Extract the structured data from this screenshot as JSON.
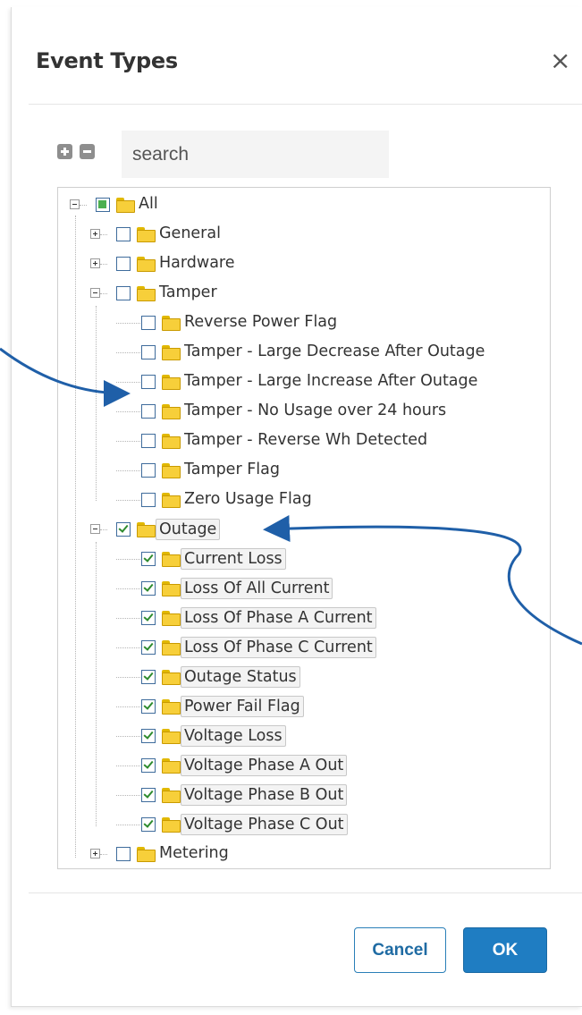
{
  "dialog": {
    "title": "Event Types",
    "close_icon": "×",
    "close_icon_name": "close-icon"
  },
  "toolbar": {
    "expand_all_icon": "plus-square-icon",
    "collapse_all_icon": "minus-square-icon",
    "search_placeholder": "search",
    "search_value": ""
  },
  "tree": {
    "nodes": [
      {
        "label": "All",
        "level": 0,
        "expander": "minus",
        "check": "partial",
        "folder": "folder-open-icon"
      },
      {
        "label": "General",
        "level": 1,
        "expander": "plus",
        "check": "unchecked",
        "folder": "folder-icon"
      },
      {
        "label": "Hardware",
        "level": 1,
        "expander": "plus",
        "check": "unchecked",
        "folder": "folder-icon"
      },
      {
        "label": "Tamper",
        "level": 1,
        "expander": "minus",
        "check": "unchecked",
        "folder": "folder-open-icon"
      },
      {
        "label": "Reverse Power Flag",
        "level": 2,
        "check": "unchecked",
        "folder": "folder-icon"
      },
      {
        "label": "Tamper - Large Decrease After Outage",
        "level": 2,
        "check": "unchecked",
        "folder": "folder-icon"
      },
      {
        "label": "Tamper - Large Increase After Outage",
        "level": 2,
        "check": "unchecked",
        "folder": "folder-icon"
      },
      {
        "label": "Tamper - No Usage over 24 hours",
        "level": 2,
        "check": "unchecked",
        "folder": "folder-icon"
      },
      {
        "label": "Tamper - Reverse Wh Detected",
        "level": 2,
        "check": "unchecked",
        "folder": "folder-icon"
      },
      {
        "label": "Tamper Flag",
        "level": 2,
        "check": "unchecked",
        "folder": "folder-icon"
      },
      {
        "label": "Zero Usage Flag",
        "level": 2,
        "check": "unchecked",
        "folder": "folder-icon"
      },
      {
        "label": "Outage",
        "level": 1,
        "expander": "minus",
        "check": "checked",
        "folder": "folder-open-icon",
        "selected": true
      },
      {
        "label": "Current Loss",
        "level": 2,
        "check": "checked",
        "folder": "folder-icon",
        "selected": true
      },
      {
        "label": "Loss Of All Current",
        "level": 2,
        "check": "checked",
        "folder": "folder-icon",
        "selected": true
      },
      {
        "label": "Loss Of Phase A Current",
        "level": 2,
        "check": "checked",
        "folder": "folder-icon",
        "selected": true
      },
      {
        "label": "Loss Of Phase C Current",
        "level": 2,
        "check": "checked",
        "folder": "folder-icon",
        "selected": true
      },
      {
        "label": "Outage Status",
        "level": 2,
        "check": "checked",
        "folder": "folder-icon",
        "selected": true
      },
      {
        "label": "Power Fail Flag",
        "level": 2,
        "check": "checked",
        "folder": "folder-icon",
        "selected": true
      },
      {
        "label": "Voltage Loss",
        "level": 2,
        "check": "checked",
        "folder": "folder-icon",
        "selected": true
      },
      {
        "label": "Voltage Phase A Out",
        "level": 2,
        "check": "checked",
        "folder": "folder-icon",
        "selected": true
      },
      {
        "label": "Voltage Phase B Out",
        "level": 2,
        "check": "checked",
        "folder": "folder-icon",
        "selected": true
      },
      {
        "label": "Voltage Phase C Out",
        "level": 2,
        "check": "checked",
        "folder": "folder-icon",
        "selected": true
      },
      {
        "label": "Metering",
        "level": 1,
        "expander": "plus",
        "check": "unchecked",
        "folder": "folder-icon"
      }
    ]
  },
  "footer": {
    "cancel_label": "Cancel",
    "ok_label": "OK"
  },
  "colors": {
    "primary": "#1f7dc2",
    "annotation_arrow": "#1f5fa8",
    "folder": "#f7cf3a",
    "check_green": "#2e8b2e"
  },
  "annotations": [
    {
      "name": "callout-arrow-to-tamper-items",
      "icon": "curved-arrow"
    },
    {
      "name": "callout-arrow-to-outage-node",
      "icon": "curved-arrow"
    }
  ]
}
